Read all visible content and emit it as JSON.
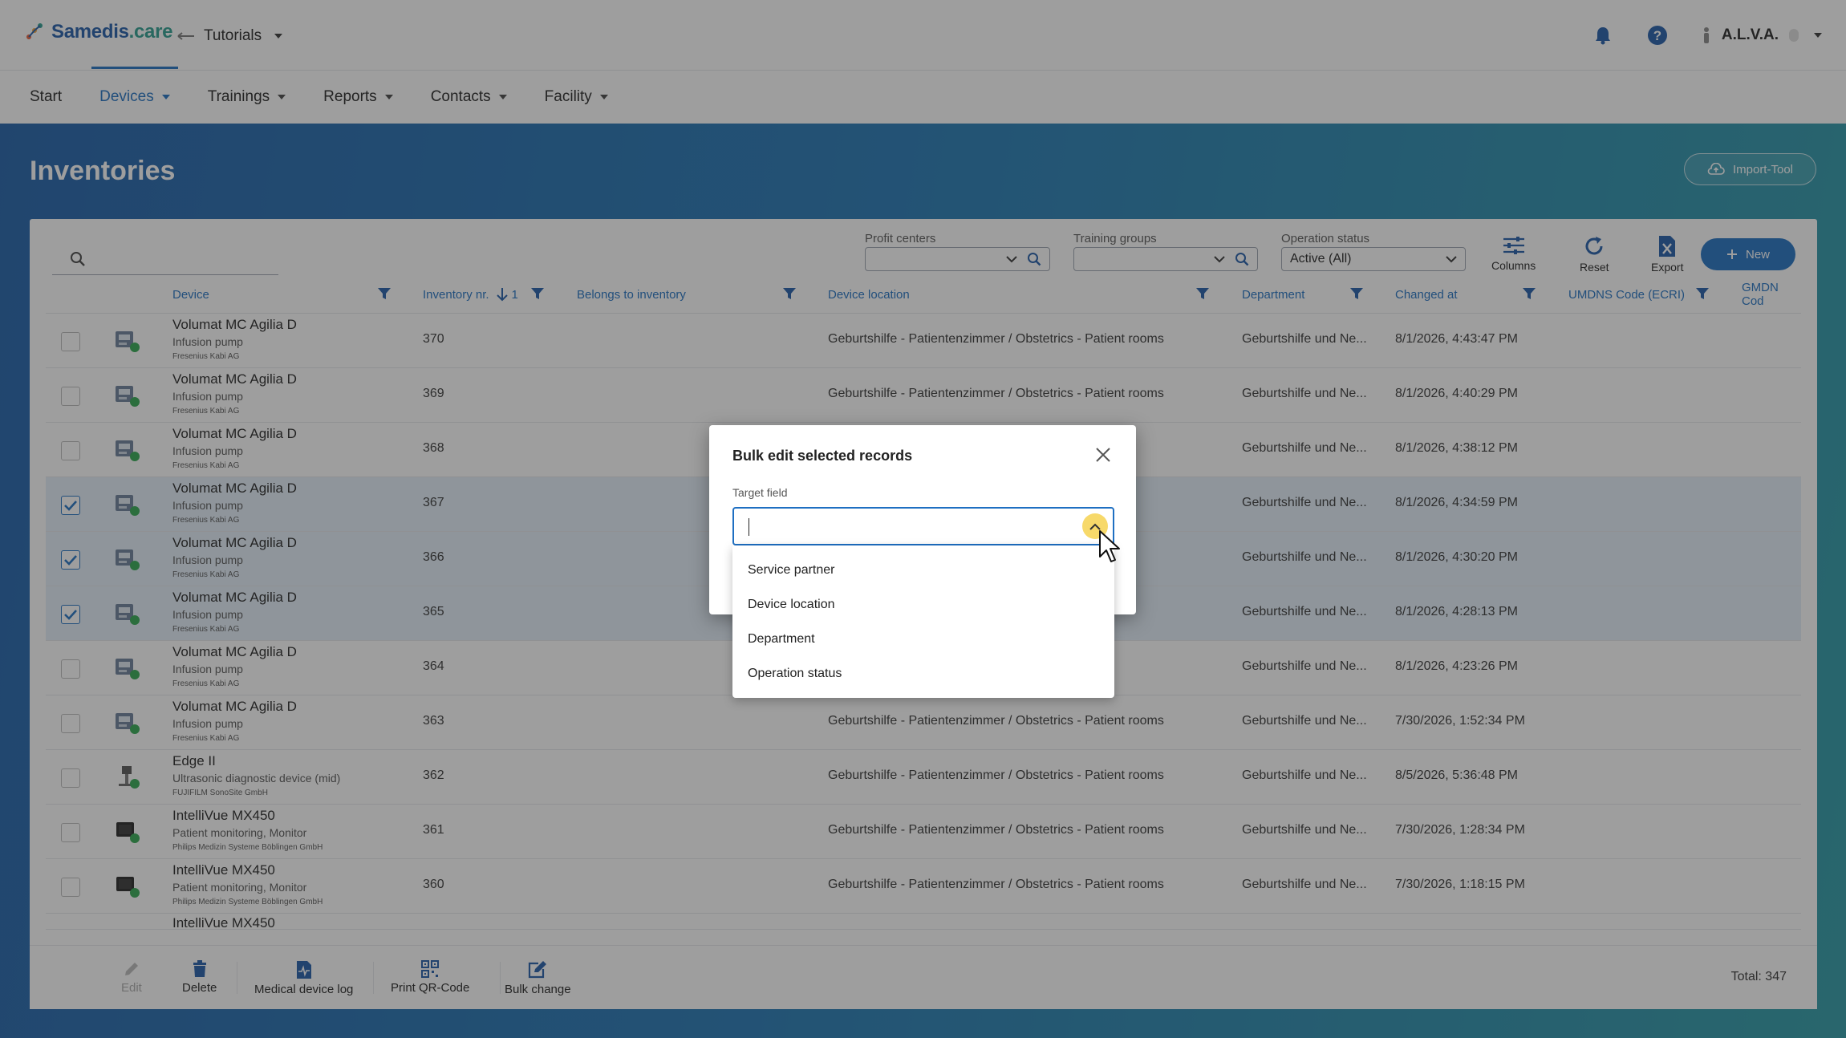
{
  "header": {
    "brand_main": "Samedis",
    "brand_suffix": ".care",
    "workspace": "Tutorials",
    "user": "A.L.V.A."
  },
  "nav": {
    "items": [
      {
        "label": "Start",
        "active": false,
        "has_menu": false
      },
      {
        "label": "Devices",
        "active": true,
        "has_menu": true
      },
      {
        "label": "Trainings",
        "active": false,
        "has_menu": true
      },
      {
        "label": "Reports",
        "active": false,
        "has_menu": true
      },
      {
        "label": "Contacts",
        "active": false,
        "has_menu": true
      },
      {
        "label": "Facility",
        "active": false,
        "has_menu": true
      }
    ]
  },
  "page": {
    "title": "Inventories",
    "import_label": "Import-Tool"
  },
  "toolbar": {
    "search_placeholder": "",
    "profit_centers_label": "Profit centers",
    "profit_centers_value": "",
    "training_groups_label": "Training groups",
    "training_groups_value": "",
    "operation_status_label": "Operation status",
    "operation_status_value": "Active (All)",
    "columns_label": "Columns",
    "reset_label": "Reset",
    "export_label": "Export",
    "new_label": "New"
  },
  "table": {
    "columns": {
      "device": "Device",
      "inventory": "Inventory nr.",
      "inventory_sort": "1",
      "belongs": "Belongs to inventory",
      "location": "Device location",
      "department": "Department",
      "changed": "Changed at",
      "umdns": "UMDNS Code (ECRI)",
      "gmdn": "GMDN Cod"
    },
    "rows": [
      {
        "name": "Volumat MC Agilia D",
        "type": "Infusion pump",
        "manufacturer": "Fresenius Kabi AG",
        "inventory": "370",
        "location": "Geburtshilfe - Patientenzimmer / Obstetrics - Patient rooms",
        "department": "Geburtshilfe und Ne...",
        "changed": "8/1/2026, 4:43:47 PM",
        "selected": false,
        "icon": "pump"
      },
      {
        "name": "Volumat MC Agilia D",
        "type": "Infusion pump",
        "manufacturer": "Fresenius Kabi AG",
        "inventory": "369",
        "location": "Geburtshilfe - Patientenzimmer / Obstetrics - Patient rooms",
        "department": "Geburtshilfe und Ne...",
        "changed": "8/1/2026, 4:40:29 PM",
        "selected": false,
        "icon": "pump"
      },
      {
        "name": "Volumat MC Agilia D",
        "type": "Infusion pump",
        "manufacturer": "Fresenius Kabi AG",
        "inventory": "368",
        "location": "oms",
        "department": "Geburtshilfe und Ne...",
        "changed": "8/1/2026, 4:38:12 PM",
        "selected": false,
        "icon": "pump"
      },
      {
        "name": "Volumat MC Agilia D",
        "type": "Infusion pump",
        "manufacturer": "Fresenius Kabi AG",
        "inventory": "367",
        "location": "oms",
        "department": "Geburtshilfe und Ne...",
        "changed": "8/1/2026, 4:34:59 PM",
        "selected": true,
        "icon": "pump"
      },
      {
        "name": "Volumat MC Agilia D",
        "type": "Infusion pump",
        "manufacturer": "Fresenius Kabi AG",
        "inventory": "366",
        "location": "oms",
        "department": "Geburtshilfe und Ne...",
        "changed": "8/1/2026, 4:30:20 PM",
        "selected": true,
        "icon": "pump"
      },
      {
        "name": "Volumat MC Agilia D",
        "type": "Infusion pump",
        "manufacturer": "Fresenius Kabi AG",
        "inventory": "365",
        "location": "oms",
        "department": "Geburtshilfe und Ne...",
        "changed": "8/1/2026, 4:28:13 PM",
        "selected": true,
        "icon": "pump"
      },
      {
        "name": "Volumat MC Agilia D",
        "type": "Infusion pump",
        "manufacturer": "Fresenius Kabi AG",
        "inventory": "364",
        "location": "nt rooms",
        "department": "Geburtshilfe und Ne...",
        "changed": "8/1/2026, 4:23:26 PM",
        "selected": false,
        "icon": "pump"
      },
      {
        "name": "Volumat MC Agilia D",
        "type": "Infusion pump",
        "manufacturer": "Fresenius Kabi AG",
        "inventory": "363",
        "location": "Geburtshilfe - Patientenzimmer / Obstetrics - Patient rooms",
        "department": "Geburtshilfe und Ne...",
        "changed": "7/30/2026, 1:52:34 PM",
        "selected": false,
        "icon": "pump"
      },
      {
        "name": "Edge II",
        "type": "Ultrasonic diagnostic device (mid)",
        "manufacturer": "FUJIFILM SonoSite GmbH",
        "inventory": "362",
        "location": "Geburtshilfe - Patientenzimmer / Obstetrics - Patient rooms",
        "department": "Geburtshilfe und Ne...",
        "changed": "8/5/2026, 5:36:48 PM",
        "selected": false,
        "icon": "ultrasound"
      },
      {
        "name": "IntelliVue MX450",
        "type": "Patient monitoring, Monitor",
        "manufacturer": "Philips Medizin Systeme Böblingen GmbH",
        "inventory": "361",
        "location": "Geburtshilfe - Patientenzimmer / Obstetrics - Patient rooms",
        "department": "Geburtshilfe und Ne...",
        "changed": "7/30/2026, 1:28:34 PM",
        "selected": false,
        "icon": "monitor"
      },
      {
        "name": "IntelliVue MX450",
        "type": "Patient monitoring, Monitor",
        "manufacturer": "Philips Medizin Systeme Böblingen GmbH",
        "inventory": "360",
        "location": "Geburtshilfe - Patientenzimmer / Obstetrics - Patient rooms",
        "department": "Geburtshilfe und Ne...",
        "changed": "7/30/2026, 1:18:15 PM",
        "selected": false,
        "icon": "monitor"
      }
    ],
    "partial_row_name": "IntelliVue MX450"
  },
  "bottom": {
    "edit": "Edit",
    "delete": "Delete",
    "log": "Medical device log",
    "qr": "Print QR-Code",
    "bulk": "Bulk change",
    "total": "Total: 347"
  },
  "dialog": {
    "title": "Bulk edit selected records",
    "field_label": "Target field",
    "field_value": "",
    "options": [
      "Service partner",
      "Device location",
      "Department",
      "Operation status"
    ]
  },
  "colors": {
    "accent": "#1e6fc2",
    "selected_row": "#e3effa",
    "status_green": "#2fa84f",
    "toggle_highlight": "#f7d96a"
  }
}
